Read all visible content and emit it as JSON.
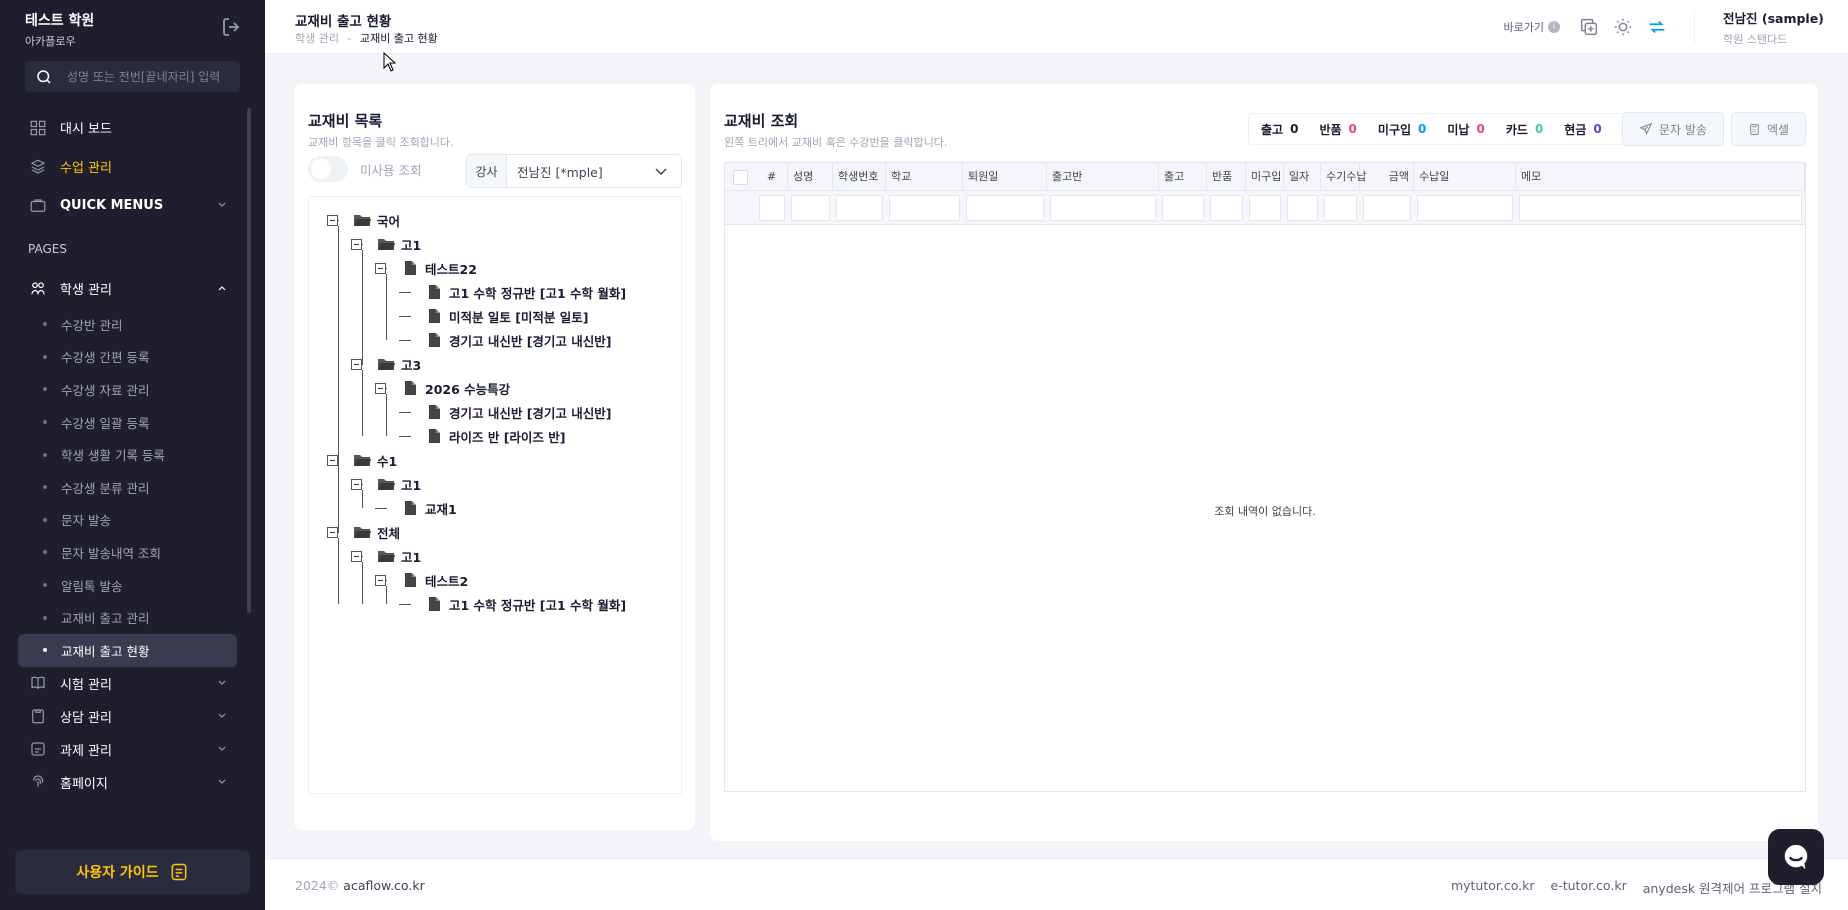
{
  "sidebar": {
    "brand_title": "테스트 학원",
    "brand_sub": "아카플로우",
    "search_placeholder": "성명 또는 전번[끝네자리] 입력",
    "top_items": [
      {
        "label": "대시 보드",
        "icon": "dashboard-icon"
      },
      {
        "label": "수업 관리",
        "icon": "class-icon"
      },
      {
        "label": "QUICK MENUS",
        "icon": "quick-menu-icon"
      }
    ],
    "section_label": "PAGES",
    "student_menu": "학생 관리",
    "sub_items": [
      "수강반 관리",
      "수강생 간편 등록",
      "수강생 자료 관리",
      "수강생 일괄 등록",
      "학생 생활 기록 등록",
      "수강생 분류 관리",
      "문자 발송",
      "문자 발송내역 조회",
      "알림톡 발송",
      "교재비 출고 관리",
      "교재비 출고 현황"
    ],
    "bottom_items": [
      {
        "label": "시험 관리",
        "icon": "book-icon"
      },
      {
        "label": "상담 관리",
        "icon": "clipboard-icon"
      },
      {
        "label": "과제 관리",
        "icon": "task-icon"
      },
      {
        "label": "홈페이지",
        "icon": "fingerprint-icon"
      }
    ],
    "guide_button": "사용자 가이드"
  },
  "header": {
    "title": "교재비 출고 현황",
    "breadcrumb_parent": "학생 관리",
    "breadcrumb_sep": "-",
    "breadcrumb_current": "교재비 출고 현황",
    "shortcut_label": "바로가기",
    "user_name": "전남진 (sample)",
    "user_plan": "학원 스탠다드"
  },
  "left_panel": {
    "title": "교재비 목록",
    "desc": "교재비 항목을 클릭 조회합니다.",
    "toggle_label": "미사용 조회",
    "teacher_label": "강사",
    "teacher_value": "전남진 [*mple]",
    "tree": [
      {
        "label": "국어",
        "type": "folder"
      },
      {
        "label": "고1",
        "type": "folder"
      },
      {
        "label": "테스트22",
        "type": "file"
      },
      {
        "label": "고1 수학 정규반 [고1 수학 월화]",
        "type": "file"
      },
      {
        "label": "미적분 일토 [미적분 일토]",
        "type": "file"
      },
      {
        "label": "경기고 내신반 [경기고 내신반]",
        "type": "file"
      },
      {
        "label": "고3",
        "type": "folder"
      },
      {
        "label": "2026 수능특강",
        "type": "file"
      },
      {
        "label": "경기고 내신반 [경기고 내신반]",
        "type": "file"
      },
      {
        "label": "라이즈 반 [라이즈 반]",
        "type": "file"
      },
      {
        "label": "수1",
        "type": "folder"
      },
      {
        "label": "고1",
        "type": "folder"
      },
      {
        "label": "교재1",
        "type": "file"
      },
      {
        "label": "전체",
        "type": "folder"
      },
      {
        "label": "고1",
        "type": "folder"
      },
      {
        "label": "테스트2",
        "type": "file"
      },
      {
        "label": "고1 수학 정규반 [고1 수학 월화]",
        "type": "file"
      }
    ]
  },
  "right_panel": {
    "title": "교재비 조회",
    "desc": "왼쪽 트리에서 교재비 혹은 수강반을 클릭합니다.",
    "stats": [
      {
        "label": "출고",
        "value": "0",
        "color": "#181c32"
      },
      {
        "label": "반품",
        "value": "0",
        "color": "#f1416c"
      },
      {
        "label": "미구입",
        "value": "0",
        "color": "#009ef7"
      },
      {
        "label": "미납",
        "value": "0",
        "color": "#f1416c"
      },
      {
        "label": "카드",
        "value": "0",
        "color": "#50cd89"
      },
      {
        "label": "현금",
        "value": "0",
        "color": "#7239ea"
      }
    ],
    "sms_button": "문자 발송",
    "excel_button": "엑셀",
    "columns": [
      "#",
      "성명",
      "학생번호",
      "학교",
      "퇴원일",
      "출고반",
      "출고",
      "반품",
      "미구입",
      "일자",
      "수기수납",
      "금액",
      "수납일",
      "메모"
    ],
    "empty_message": "조회 내역이 없습니다."
  },
  "footer": {
    "year": "2024©",
    "site": "acaflow.co.kr",
    "links": [
      "mytutor.co.kr",
      "e-tutor.co.kr",
      "anydesk 원격제어 프로그램 설치"
    ]
  }
}
